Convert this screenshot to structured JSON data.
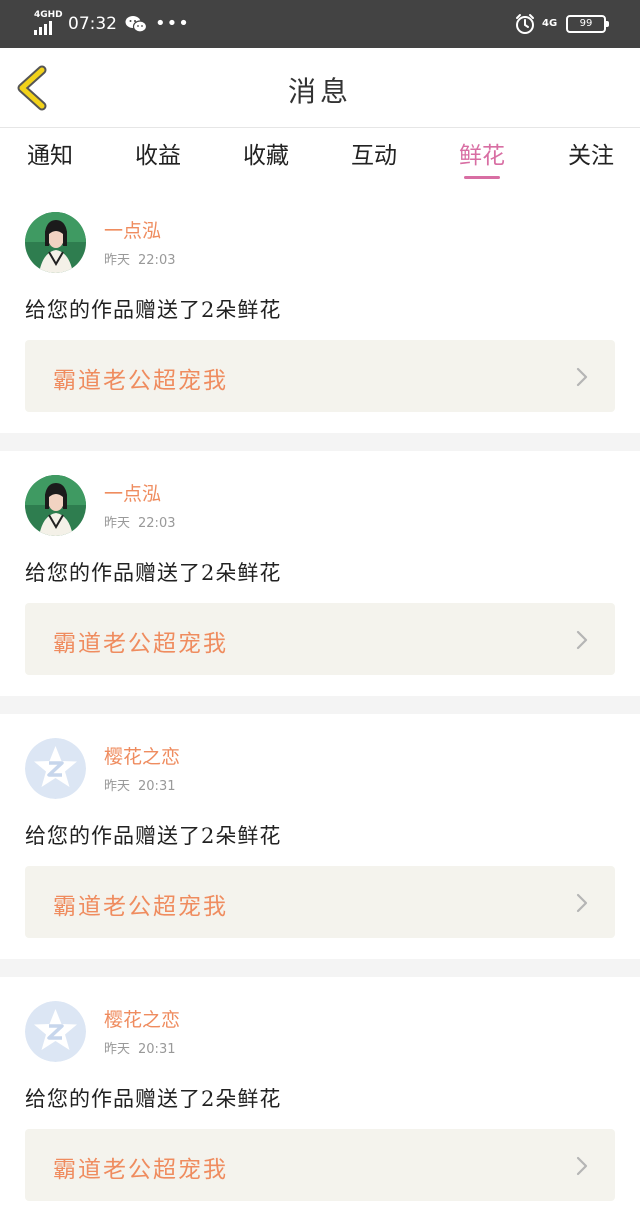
{
  "status_bar": {
    "network": "4GHD",
    "time": "07:32",
    "dots": "•••",
    "right_network": "4G",
    "battery": "99"
  },
  "header": {
    "title": "消息"
  },
  "tabs": [
    {
      "label": "通知"
    },
    {
      "label": "收益"
    },
    {
      "label": "收藏"
    },
    {
      "label": "互动"
    },
    {
      "label": "鲜花",
      "active": true
    },
    {
      "label": "关注"
    }
  ],
  "messages": [
    {
      "username": "一点泓",
      "date": "昨天",
      "time": "22:03",
      "avatar": "photo",
      "content": "给您的作品赠送了2朵鲜花",
      "work": "霸道老公超宠我"
    },
    {
      "username": "一点泓",
      "date": "昨天",
      "time": "22:03",
      "avatar": "photo",
      "content": "给您的作品赠送了2朵鲜花",
      "work": "霸道老公超宠我"
    },
    {
      "username": "樱花之恋",
      "date": "昨天",
      "time": "20:31",
      "avatar": "default-star",
      "content": "给您的作品赠送了2朵鲜花",
      "work": "霸道老公超宠我"
    },
    {
      "username": "樱花之恋",
      "date": "昨天",
      "time": "20:31",
      "avatar": "default-star",
      "content": "给您的作品赠送了2朵鲜花",
      "work": "霸道老公超宠我"
    }
  ],
  "colors": {
    "status_bar_bg": "#434343",
    "accent_pink": "#d86ea3",
    "username_orange": "#ef8c5f",
    "card_bg": "#f4f3ed",
    "back_arrow_yellow": "#f2d21a"
  }
}
